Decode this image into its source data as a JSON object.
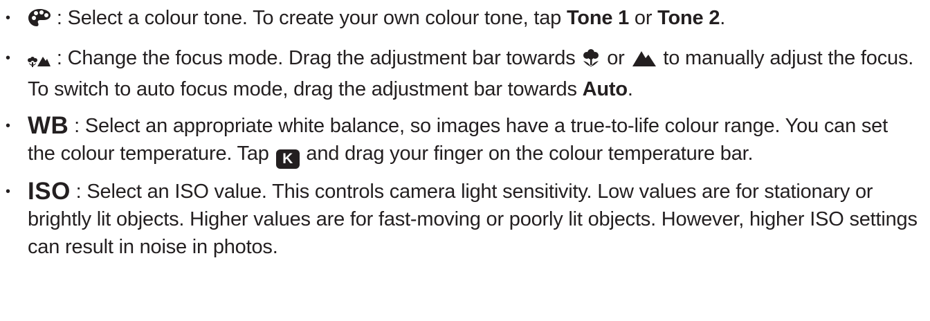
{
  "items": [
    {
      "icon": "palette-icon",
      "sep": ": ",
      "text1": "Select a colour tone. To create your own colour tone, tap ",
      "bold1": "Tone 1",
      "text2": " or ",
      "bold2": "Tone 2",
      "text3": "."
    },
    {
      "icon": "focus-mode-icon",
      "sep": ": ",
      "text1": "Change the focus mode. Drag the adjustment bar towards ",
      "icon_a": "macro-flower-icon",
      "text2": " or ",
      "icon_b": "mountain-icon",
      "text3": " to manually adjust the focus. To switch to auto focus mode, drag the adjustment bar towards ",
      "bold1": "Auto",
      "text4": "."
    },
    {
      "label": "WB",
      "sep": ": ",
      "text1": "Select an appropriate white balance, so images have a true-to-life colour range. You can set the colour temperature. Tap ",
      "key": "K",
      "text2": " and drag your finger on the colour temperature bar."
    },
    {
      "label": "ISO",
      "sep": ": ",
      "text1": "Select an ISO value. This controls camera light sensitivity. Low values are for stationary or brightly lit objects. Higher values are for fast-moving or poorly lit objects. However, higher ISO settings can result in noise in photos."
    }
  ],
  "bullet": "•"
}
